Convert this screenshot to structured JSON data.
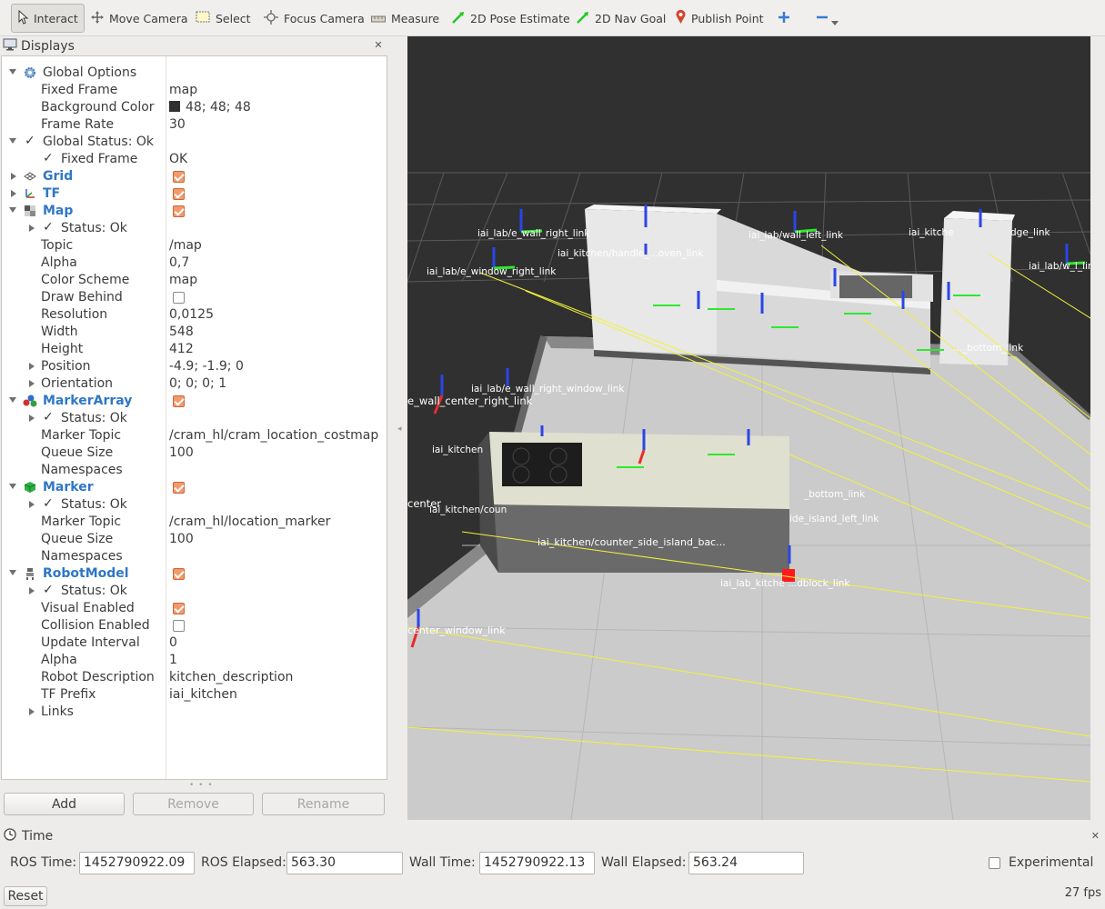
{
  "toolbar": {
    "interact": "Interact",
    "move_camera": "Move Camera",
    "select": "Select",
    "focus_camera": "Focus Camera",
    "measure": "Measure",
    "pose_estimate": "2D Pose Estimate",
    "nav_goal": "2D Nav Goal",
    "publish_point": "Publish Point"
  },
  "displays": {
    "title": "Displays",
    "rows": [
      {
        "label": "Global Options",
        "value": ""
      },
      {
        "label": "Fixed Frame",
        "value": "map"
      },
      {
        "label": "Background Color",
        "value": "48; 48; 48"
      },
      {
        "label": "Frame Rate",
        "value": "30"
      },
      {
        "label": "Global Status: Ok",
        "value": ""
      },
      {
        "label": "Fixed Frame",
        "value": "OK"
      },
      {
        "label": "Grid",
        "value": ""
      },
      {
        "label": "TF",
        "value": ""
      },
      {
        "label": "Map",
        "value": ""
      },
      {
        "label": "Status: Ok",
        "value": ""
      },
      {
        "label": "Topic",
        "value": "/map"
      },
      {
        "label": "Alpha",
        "value": "0,7"
      },
      {
        "label": "Color Scheme",
        "value": "map"
      },
      {
        "label": "Draw Behind",
        "value": ""
      },
      {
        "label": "Resolution",
        "value": "0,0125"
      },
      {
        "label": "Width",
        "value": "548"
      },
      {
        "label": "Height",
        "value": "412"
      },
      {
        "label": "Position",
        "value": "-4.9; -1.9; 0"
      },
      {
        "label": "Orientation",
        "value": "0; 0; 0; 1"
      },
      {
        "label": "MarkerArray",
        "value": ""
      },
      {
        "label": "Status: Ok",
        "value": ""
      },
      {
        "label": "Marker Topic",
        "value": "/cram_hl/cram_location_costmap"
      },
      {
        "label": "Queue Size",
        "value": "100"
      },
      {
        "label": "Namespaces",
        "value": ""
      },
      {
        "label": "Marker",
        "value": ""
      },
      {
        "label": "Status: Ok",
        "value": ""
      },
      {
        "label": "Marker Topic",
        "value": "/cram_hl/location_marker"
      },
      {
        "label": "Queue Size",
        "value": "100"
      },
      {
        "label": "Namespaces",
        "value": ""
      },
      {
        "label": "RobotModel",
        "value": ""
      },
      {
        "label": "Status: Ok",
        "value": ""
      },
      {
        "label": "Visual Enabled",
        "value": ""
      },
      {
        "label": "Collision Enabled",
        "value": ""
      },
      {
        "label": "Update Interval",
        "value": "0"
      },
      {
        "label": "Alpha",
        "value": "1"
      },
      {
        "label": "Robot Description",
        "value": "kitchen_description"
      },
      {
        "label": "TF Prefix",
        "value": "iai_kitchen"
      },
      {
        "label": "Links",
        "value": ""
      }
    ],
    "checkboxes": {
      "grid": true,
      "tf": true,
      "map": true,
      "draw_behind": false,
      "markerarray": true,
      "marker": true,
      "robotmodel": true,
      "visual_enabled": true,
      "collision_enabled": false
    },
    "background_color_hex": "#303030",
    "buttons": {
      "add": "Add",
      "remove": "Remove",
      "rename": "Rename"
    }
  },
  "viewport": {
    "frame_labels": [
      "iai_lab/e_wall_right_link",
      "iai_lab/wall_left_link",
      "iai_kitche",
      "dge_link",
      "iai_lab/w_l_link",
      "iai_lab/e_window_right_link",
      "iai_lab/e_wall_right_window_link",
      "e_wall_center_right_link",
      "iai_kitchen/counter_side_island_bac...",
      "center_window_link",
      "iai_kitchen",
      "iai_kitchen/coun",
      "center",
      "_bottom_link",
      "ide_island_left_link",
      "iai_lab_kitche   ...dblock_link",
      "iai_kitchen/handle_...oven_link",
      "..._bottom_link"
    ]
  },
  "time": {
    "title": "Time",
    "ros_time_label": "ROS Time:",
    "ros_time": "1452790922.09",
    "ros_elapsed_label": "ROS Elapsed:",
    "ros_elapsed": "563.30",
    "wall_time_label": "Wall Time:",
    "wall_time": "1452790922.13",
    "wall_elapsed_label": "Wall Elapsed:",
    "wall_elapsed": "563.24",
    "experimental": "Experimental"
  },
  "status": {
    "reset": "Reset",
    "fps": "27 fps"
  }
}
